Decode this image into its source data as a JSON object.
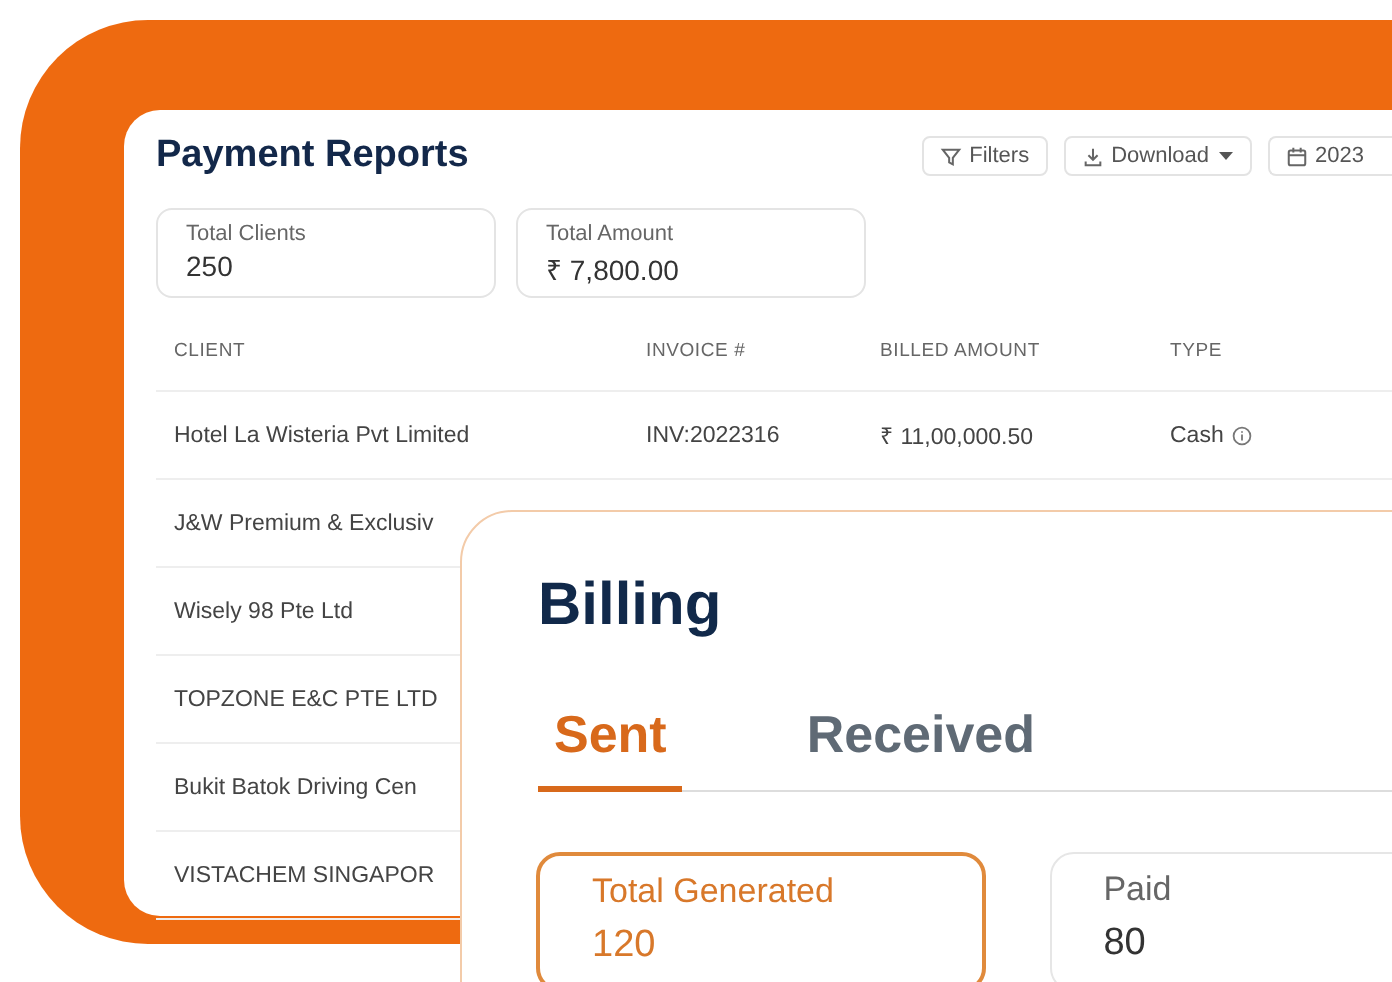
{
  "reports": {
    "title": "Payment Reports",
    "actions": [
      {
        "kind": "filter",
        "label": "Filters"
      },
      {
        "kind": "download",
        "label": "Download"
      },
      {
        "kind": "calendar",
        "label": "2023"
      }
    ],
    "stats": [
      {
        "label": "Total Clients",
        "value": "250"
      },
      {
        "label": "Total Amount",
        "value": "₹ 7,800.00"
      }
    ],
    "table": {
      "columns": [
        "CLIENT",
        "INVOICE #",
        "BILLED AMOUNT",
        "TYPE"
      ],
      "rows": [
        {
          "cells": [
            "Hotel La Wisteria Pvt Limited",
            "INV:2022316",
            "₹ 11,00,000.50",
            "Cash"
          ]
        },
        {
          "cells": [
            "J&W Premium & Exclusiv"
          ]
        },
        {
          "cells": [
            "Wisely 98 Pte Ltd"
          ]
        },
        {
          "cells": [
            "TOPZONE E&C PTE LTD"
          ]
        },
        {
          "cells": [
            "Bukit Batok Driving Cen"
          ]
        },
        {
          "cells": [
            "VISTACHEM SINGAPOR"
          ]
        }
      ]
    }
  },
  "billing": {
    "title": "Billing",
    "tabs": [
      {
        "label": "Sent",
        "selected": true
      },
      {
        "label": "Received",
        "selected": false
      }
    ],
    "stats": [
      {
        "label": "Total Generated",
        "value": "120",
        "selected": true
      },
      {
        "label": "Paid",
        "value": "80",
        "selected": false
      }
    ]
  }
}
